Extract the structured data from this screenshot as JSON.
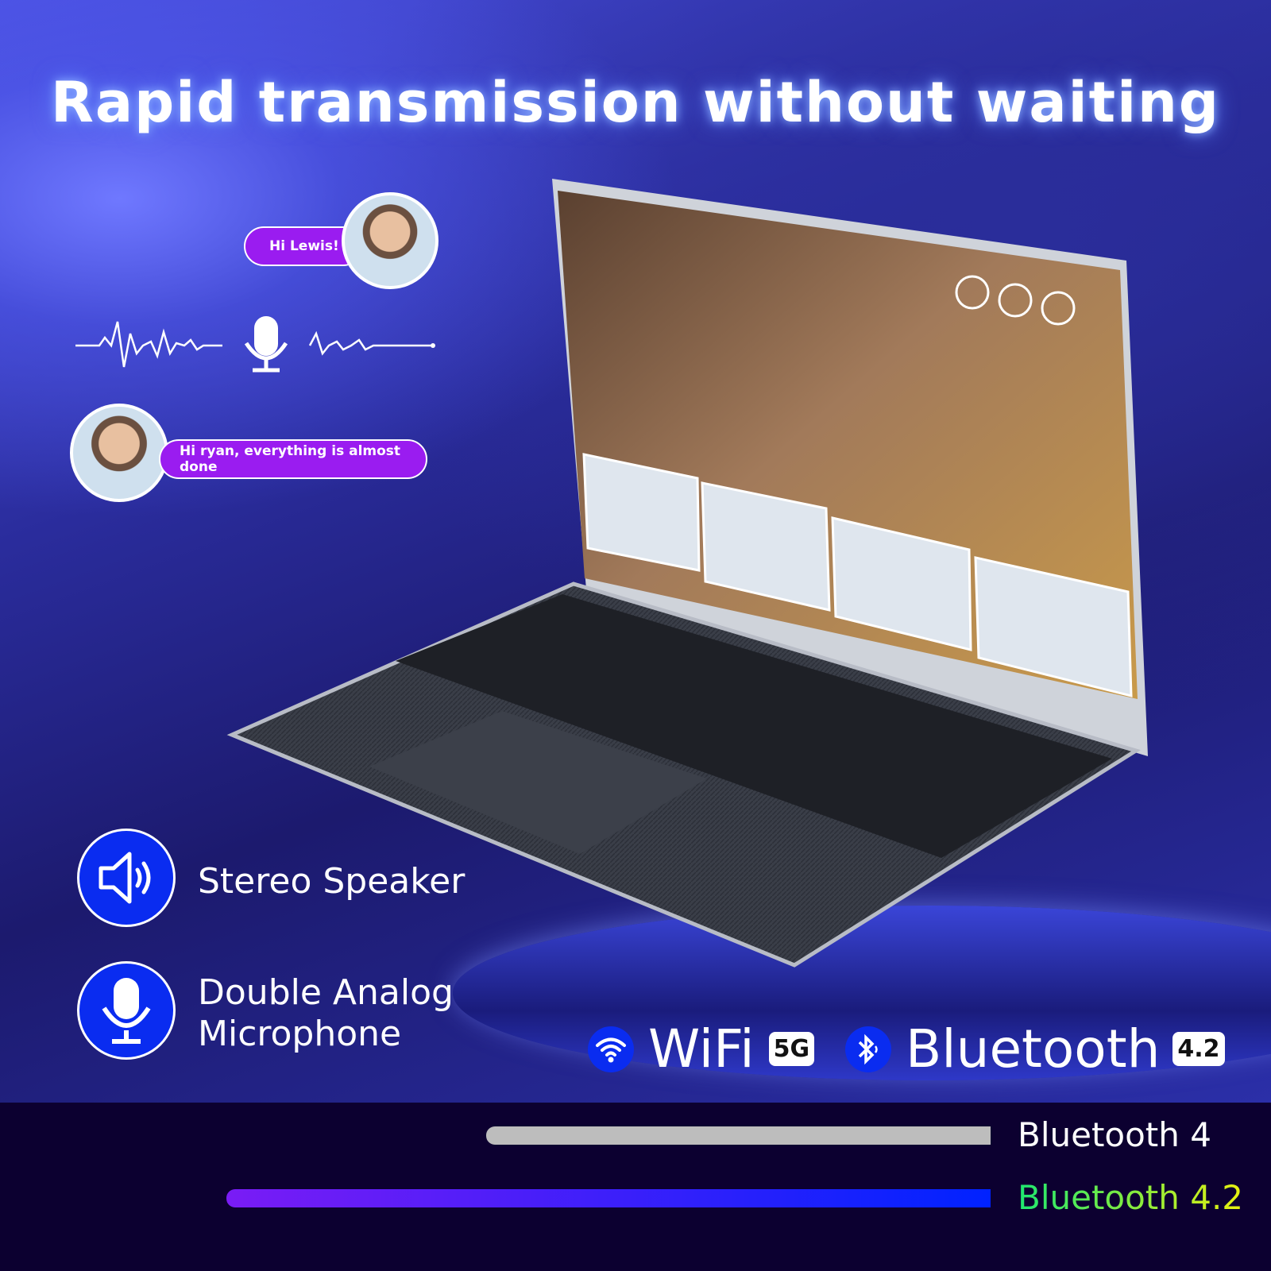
{
  "headline": "Rapid transmission without waiting",
  "chat": {
    "message_1": "Hi Lewis!",
    "message_2": "Hi ryan, everything is almost done"
  },
  "features": [
    {
      "icon": "speaker-icon",
      "label": "Stereo Speaker"
    },
    {
      "icon": "microphone-icon",
      "label_line1": "Double Analog",
      "label_line2": "Microphone"
    }
  ],
  "connectivity": {
    "wifi_label": "WiFi",
    "wifi_badge": "5G",
    "bluetooth_label": "Bluetooth",
    "bluetooth_badge": "4.2"
  },
  "comparison": [
    {
      "label": "Bluetooth 4",
      "level": 0.66,
      "color": "#bdbdbd"
    },
    {
      "label": "Bluetooth 4.2",
      "level": 1.0,
      "color_start": "#7a1cf5",
      "color_end": "#0022ff"
    }
  ],
  "colors": {
    "accent_blue": "#0a2cf0",
    "bubble_purple": "#9a1cf0",
    "band": "#0c0030"
  }
}
